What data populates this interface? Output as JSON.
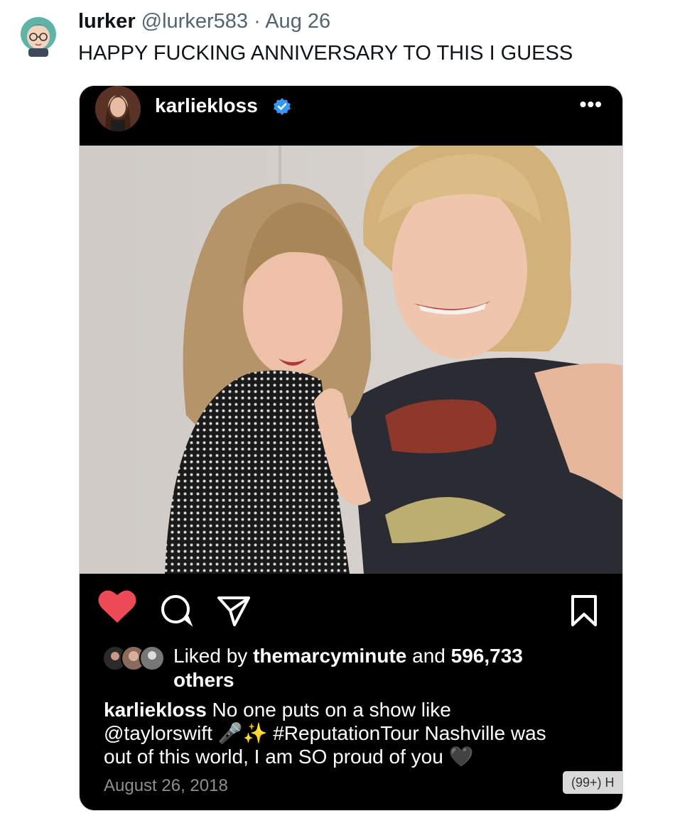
{
  "tweet": {
    "display_name": "lurker",
    "handle": "@lurker583",
    "separator": "·",
    "date": "Aug 26",
    "text": "HAPPY FUCKING ANNIVERSARY TO THIS I GUESS"
  },
  "instagram_post": {
    "username": "karliekloss",
    "more_icon": "more-horizontal-icon",
    "more_glyph": "•••",
    "likes": {
      "prefix": "Liked by ",
      "liker": "themarcyminute",
      "middle": " and ",
      "count": "596,733",
      "suffix": "others"
    },
    "caption": {
      "username": "karliekloss",
      "line1": " No one puts on a show like",
      "mention": "@taylorswift",
      "emojis": "🎤✨",
      "hashtag": "#ReputationTour",
      "line2_rest": " Nashville was",
      "line3": "out of this world, I am SO proud of you",
      "heart": "🖤"
    },
    "date": "August 26, 2018",
    "overlay_badge": "(99+) H",
    "colors": {
      "heart": "#ed4956",
      "verified": "#3897f0",
      "background": "#000000"
    }
  }
}
